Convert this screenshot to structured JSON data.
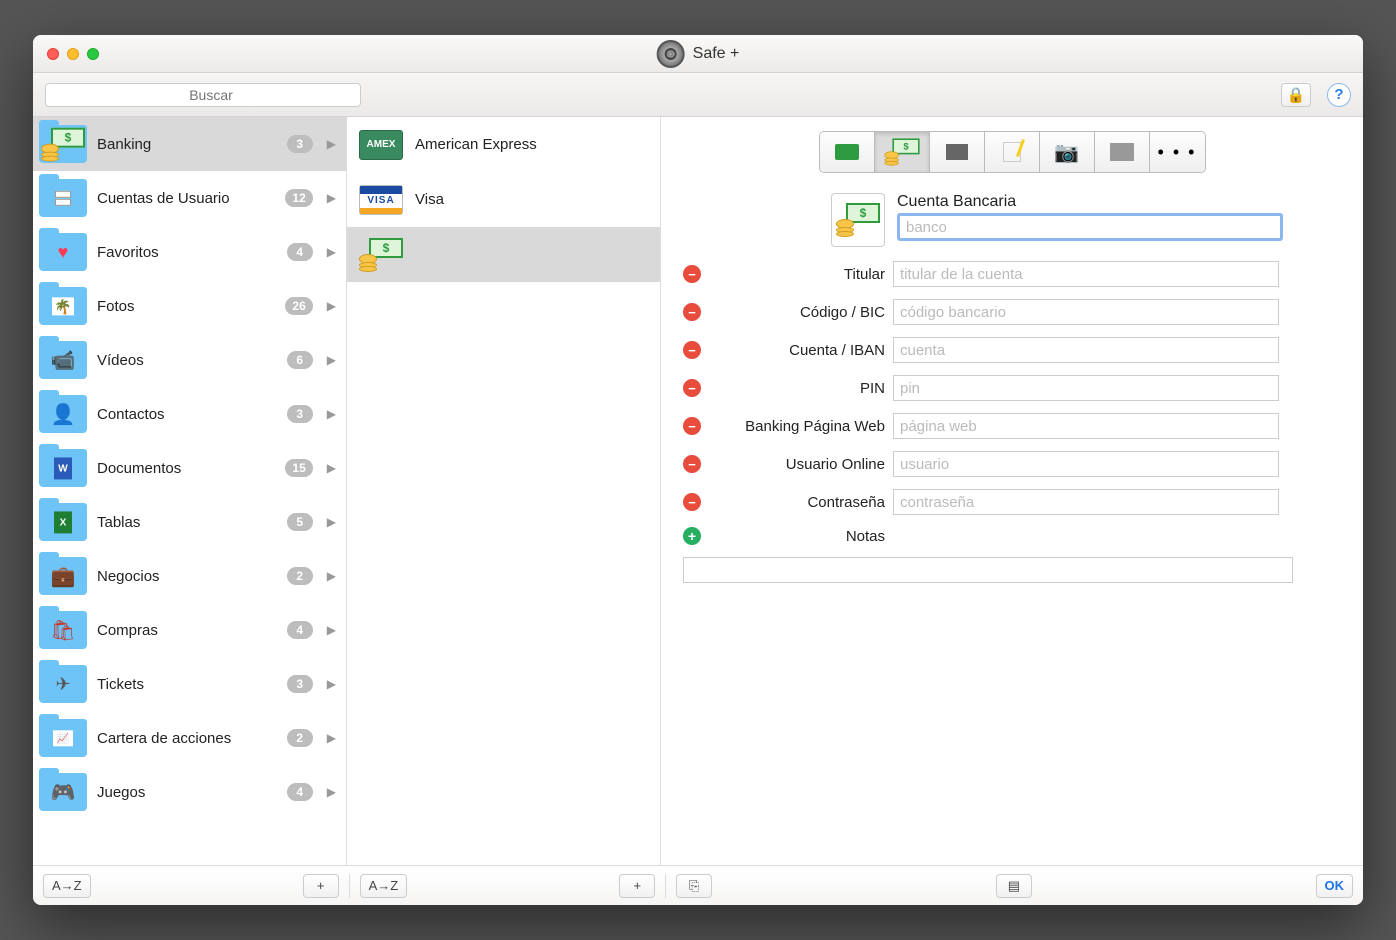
{
  "app": {
    "title": "Safe +"
  },
  "search": {
    "placeholder": "Buscar"
  },
  "sidebar": {
    "items": [
      {
        "label": "Banking",
        "count": "3",
        "icon": "money"
      },
      {
        "label": "Cuentas de Usuario",
        "count": "12",
        "icon": "accounts"
      },
      {
        "label": "Favoritos",
        "count": "4",
        "icon": "heart"
      },
      {
        "label": "Fotos",
        "count": "26",
        "icon": "photo"
      },
      {
        "label": "Vídeos",
        "count": "6",
        "icon": "cam"
      },
      {
        "label": "Contactos",
        "count": "3",
        "icon": "person"
      },
      {
        "label": "Documentos",
        "count": "15",
        "icon": "doc"
      },
      {
        "label": "Tablas",
        "count": "5",
        "icon": "xls"
      },
      {
        "label": "Negocios",
        "count": "2",
        "icon": "brief"
      },
      {
        "label": "Compras",
        "count": "4",
        "icon": "bag"
      },
      {
        "label": "Tickets",
        "count": "3",
        "icon": "plane"
      },
      {
        "label": "Cartera de acciones",
        "count": "2",
        "icon": "chart"
      },
      {
        "label": "Juegos",
        "count": "4",
        "icon": "game"
      }
    ]
  },
  "list": {
    "items": [
      {
        "label": "American Express"
      },
      {
        "label": "Visa"
      },
      {
        "label": ""
      }
    ]
  },
  "detail": {
    "type_label": "Cuenta Bancaria",
    "name_placeholder": "banco",
    "fields": [
      {
        "label": "Titular",
        "placeholder": "titular de la cuenta"
      },
      {
        "label": "Código / BIC",
        "placeholder": "código bancario"
      },
      {
        "label": "Cuenta / IBAN",
        "placeholder": "cuenta"
      },
      {
        "label": "PIN",
        "placeholder": "pin"
      },
      {
        "label": "Banking Página Web",
        "placeholder": "página web"
      },
      {
        "label": "Usuario Online",
        "placeholder": "usuario"
      },
      {
        "label": "Contraseña",
        "placeholder": "contraseña"
      }
    ],
    "notes_label": "Notas"
  },
  "footer": {
    "sort": "A→Z",
    "add": "+",
    "ok": "OK"
  },
  "typebar": {
    "more": "• • •"
  }
}
